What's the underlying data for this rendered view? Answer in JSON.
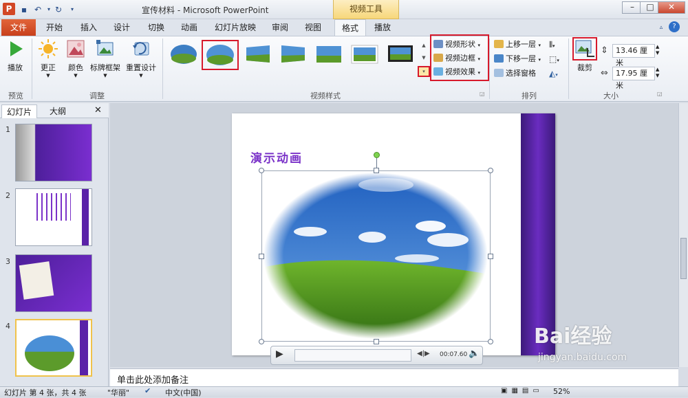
{
  "window": {
    "title": "宣传材料 - Microsoft PowerPoint",
    "contextual_tab": "视频工具",
    "app_icon": "P"
  },
  "tabs": [
    {
      "label": "文件"
    },
    {
      "label": "开始"
    },
    {
      "label": "插入"
    },
    {
      "label": "设计"
    },
    {
      "label": "切换"
    },
    {
      "label": "动画"
    },
    {
      "label": "幻灯片放映"
    },
    {
      "label": "审阅"
    },
    {
      "label": "视图"
    },
    {
      "label": "格式"
    },
    {
      "label": "播放"
    }
  ],
  "ribbon": {
    "preview": {
      "play_label": "播放",
      "group_label": "预览"
    },
    "adjust": {
      "correction_label": "更正",
      "color_label": "颜色",
      "poster_frame_label": "标牌框架",
      "reset_design_label": "重置设计",
      "group_label": "调整"
    },
    "video_styles": {
      "group_label": "视频样式",
      "shape_label": "视频形状",
      "border_label": "视频边框",
      "effects_label": "视频效果"
    },
    "arrange": {
      "bring_forward_label": "上移一层",
      "send_backward_label": "下移一层",
      "selection_pane_label": "选择窗格",
      "group_label": "排列"
    },
    "size": {
      "crop_label": "裁剪",
      "height_value": "13.46 厘米",
      "width_value": "17.95 厘米",
      "group_label": "大小"
    }
  },
  "left_pane": {
    "tabs": [
      "幻灯片",
      "大纲"
    ],
    "slides": [
      {
        "number": "1"
      },
      {
        "number": "2"
      },
      {
        "number": "3"
      },
      {
        "number": "4"
      }
    ]
  },
  "slide": {
    "title": "演示动画"
  },
  "player": {
    "time": "00:07.60"
  },
  "notes": {
    "placeholder": "单击此处添加备注"
  },
  "status": {
    "slide_info": "幻灯片 第 4 张，共 4 张",
    "theme": "\"华丽\"",
    "language": "中文(中国)",
    "zoom": "52%"
  },
  "watermark": {
    "brand": "Bai经验",
    "url": "jingyan.baidu.com"
  },
  "colors": {
    "file_tab": "#d24726",
    "slide_bar": "#5a22a8",
    "highlight": "#d7192b"
  }
}
